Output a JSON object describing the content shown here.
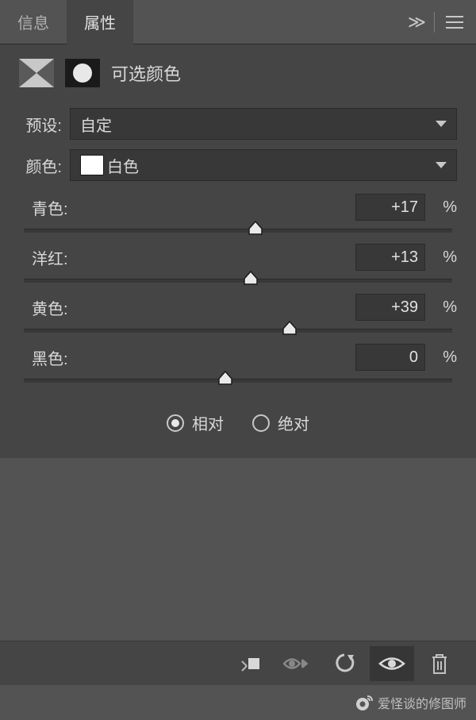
{
  "tabs": {
    "info": "信息",
    "properties": "属性"
  },
  "header": {
    "title": "可选颜色"
  },
  "preset": {
    "label": "预设:",
    "value": "自定"
  },
  "color": {
    "label": "颜色:",
    "value": "白色"
  },
  "sliders": {
    "cyan": {
      "label": "青色:",
      "value": "+17",
      "pos": 54
    },
    "magenta": {
      "label": "洋红:",
      "value": "+13",
      "pos": 53
    },
    "yellow": {
      "label": "黄色:",
      "value": "+39",
      "pos": 62
    },
    "black": {
      "label": "黑色:",
      "value": "0",
      "pos": 47
    }
  },
  "pct": "%",
  "mode": {
    "relative": "相对",
    "absolute": "绝对",
    "selected": "relative"
  },
  "watermark": "爱怪谈的修图师"
}
